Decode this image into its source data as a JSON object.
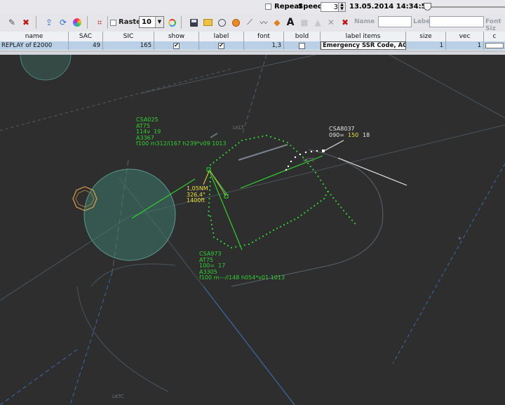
{
  "top": {
    "repeat_label": "Repeat",
    "speed_label": "Speed:",
    "speed_value": "3",
    "datetime": "13.05.2014 14:34:52",
    "slider_fraction": 0.02
  },
  "toolbar": {
    "raster_label": "Raster",
    "raster_value": "10",
    "text_tool": "A",
    "name_label": "Name",
    "label_label": "Label",
    "font_size_label": "Font Siz"
  },
  "table": {
    "columns": [
      "name",
      "SAC",
      "SIC",
      "show",
      "label",
      "font",
      "bold",
      "label items",
      "size",
      "vec",
      "c"
    ],
    "row": {
      "name": "REPLAY of E2000",
      "sac": "49",
      "sic": "165",
      "show": true,
      "label": true,
      "font": "1,3",
      "bold": false,
      "label_items": "Emergency SSR Code, ACA...",
      "size": "1",
      "vec": "1"
    }
  },
  "radar": {
    "fixes": [
      "LKLT",
      "LKTE",
      "LKTC"
    ],
    "track_csa025": [
      "CSA025",
      "AT75",
      "114v  19",
      "A3367",
      "f100 m312/i167 h239*v09 1013"
    ],
    "track_csa973": [
      "CSA973",
      "AT75",
      "100=  17",
      "A3305",
      "f100 m---/i148 h054*v01 1013"
    ],
    "track_csa8037": {
      "callsign": "CSA8037",
      "line2_a": "090=",
      "line2_b": "150",
      "line2_c": "18"
    },
    "measure": [
      "1,05NM",
      "326,4°",
      "1400ft"
    ]
  },
  "colors": {
    "track_green": "#2fd12f",
    "measure_yellow": "#e8e23a",
    "white_label": "#e6e6e6",
    "radar_bg": "#2e2e2e",
    "selection_blue": "#b9cfe6"
  }
}
